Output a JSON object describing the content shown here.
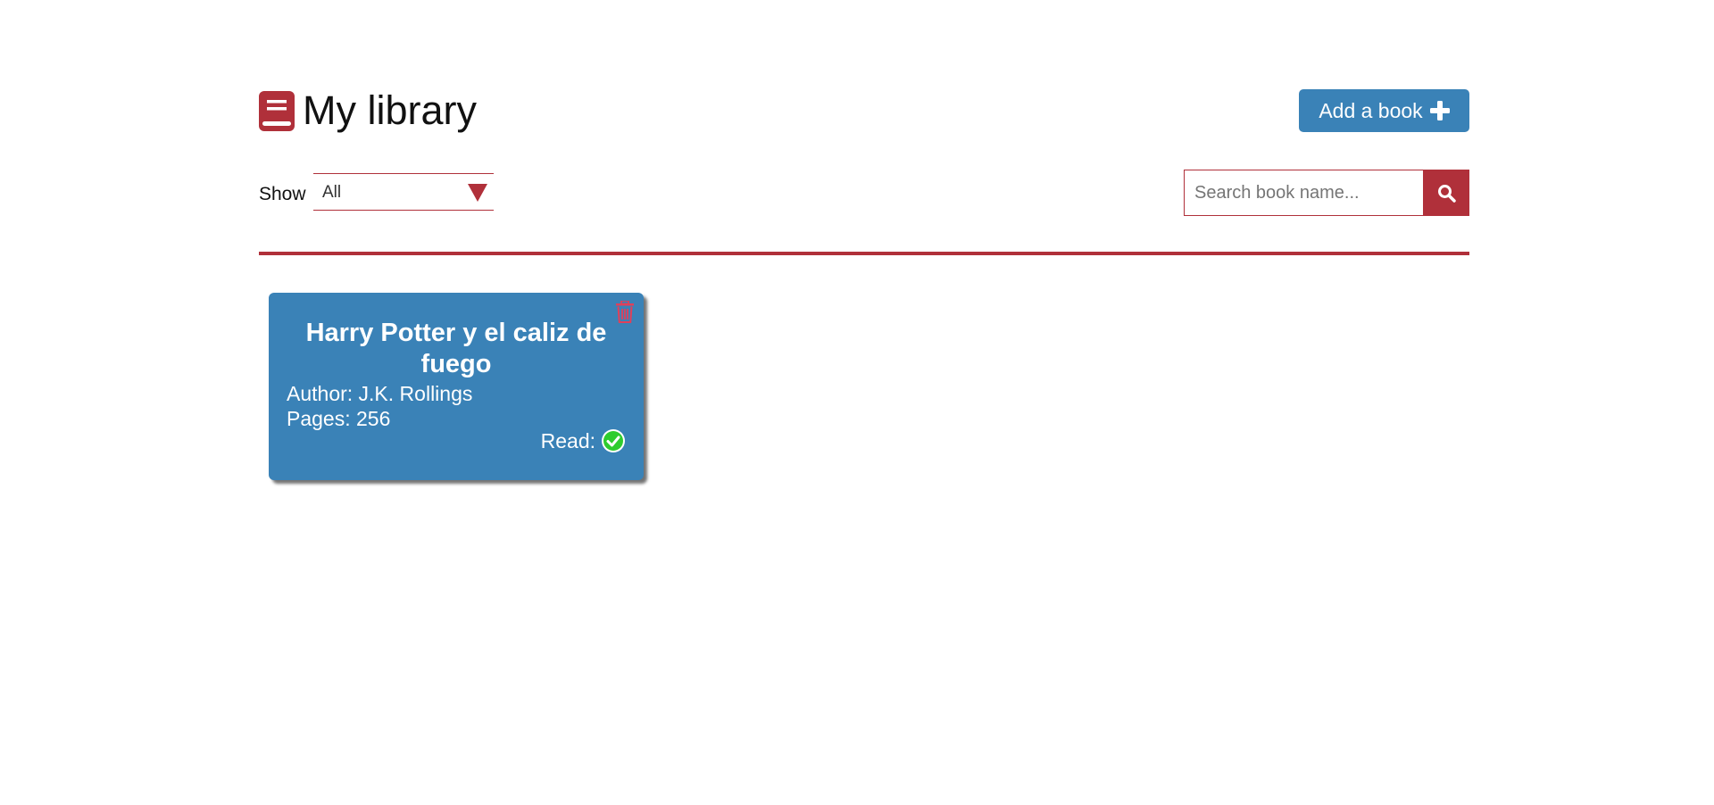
{
  "header": {
    "title": "My library",
    "add_button_label": "Add a book"
  },
  "filter": {
    "show_label": "Show",
    "selected": "All"
  },
  "search": {
    "placeholder": "Search book name..."
  },
  "books": [
    {
      "title": "Harry Potter y el caliz de fuego",
      "author": "Author: J.K. Rollings",
      "pages": "Pages: 256",
      "read_label": "Read:",
      "read": true
    }
  ],
  "colors": {
    "brand_red": "#b0303a",
    "card_blue": "#3a82b7",
    "read_green": "#2ecc2e"
  },
  "icons": {
    "logo": "book-icon",
    "add": "plus-icon",
    "select_arrow": "triangle-down-icon",
    "search": "search-icon",
    "delete": "trash-icon",
    "read": "check-circle-icon"
  }
}
